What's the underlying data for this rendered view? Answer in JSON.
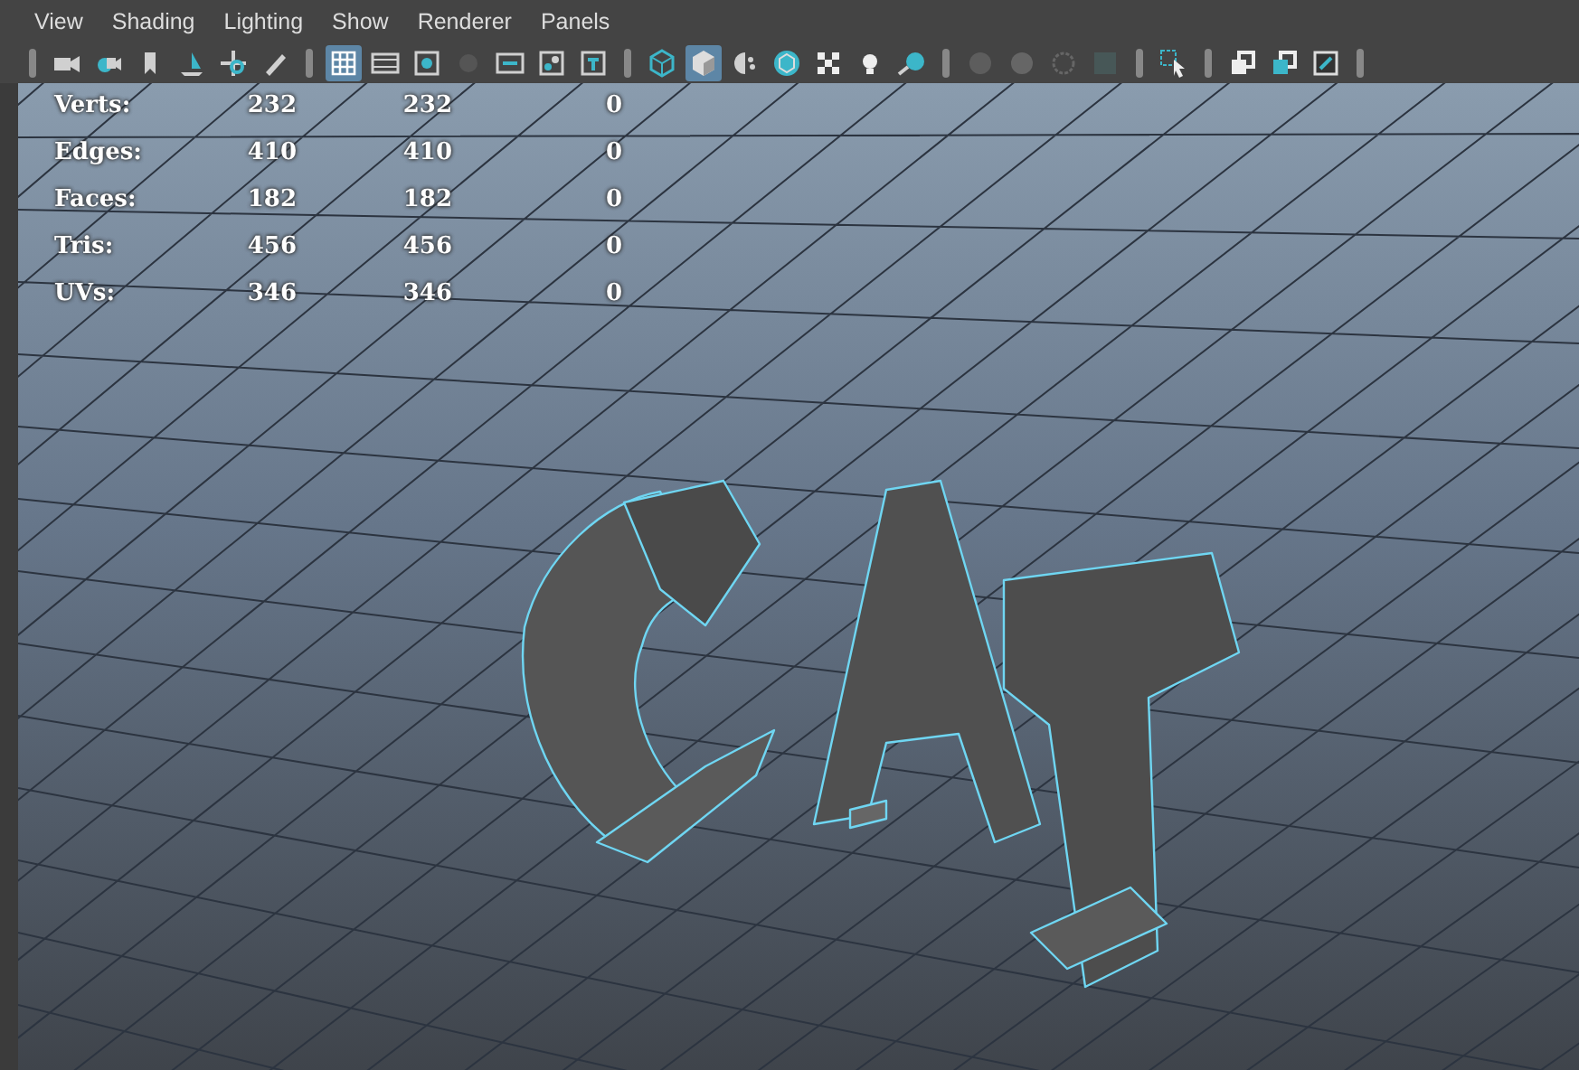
{
  "menu": [
    "View",
    "Shading",
    "Lighting",
    "Show",
    "Renderer",
    "Panels"
  ],
  "toolbar": [
    {
      "items": [
        {
          "selected": false,
          "disabled": false
        },
        {
          "selected": false,
          "disabled": false
        },
        {
          "selected": false,
          "disabled": false
        },
        {
          "selected": false,
          "disabled": false
        },
        {
          "selected": false,
          "disabled": false
        },
        {
          "selected": false,
          "disabled": false
        }
      ]
    },
    {
      "items": [
        {
          "selected": true,
          "disabled": false
        },
        {
          "selected": false,
          "disabled": false
        },
        {
          "selected": false,
          "disabled": false
        },
        {
          "selected": false,
          "disabled": true
        },
        {
          "selected": false,
          "disabled": false
        },
        {
          "selected": false,
          "disabled": false
        },
        {
          "selected": false,
          "disabled": false
        }
      ]
    },
    {
      "items": [
        {
          "selected": false,
          "disabled": false
        },
        {
          "selected": true,
          "disabled": false
        },
        {
          "selected": false,
          "disabled": false
        },
        {
          "selected": false,
          "disabled": false
        },
        {
          "selected": false,
          "disabled": false
        },
        {
          "selected": false,
          "disabled": false
        },
        {
          "selected": false,
          "disabled": false
        }
      ]
    },
    {
      "items": [
        {
          "selected": false,
          "disabled": true
        },
        {
          "selected": false,
          "disabled": true
        },
        {
          "selected": false,
          "disabled": true
        },
        {
          "selected": false,
          "disabled": true
        }
      ]
    },
    {
      "items": [
        {
          "selected": false,
          "disabled": false
        }
      ]
    },
    {
      "items": [
        {
          "selected": false,
          "disabled": false
        },
        {
          "selected": false,
          "disabled": false
        },
        {
          "selected": false,
          "disabled": false
        }
      ]
    }
  ],
  "stats": [
    {
      "label": "Verts:",
      "values": [
        "232",
        "232",
        "0"
      ]
    },
    {
      "label": "Edges:",
      "values": [
        "410",
        "410",
        "0"
      ]
    },
    {
      "label": "Faces:",
      "values": [
        "182",
        "182",
        "0"
      ]
    },
    {
      "label": "Tris:",
      "values": [
        "456",
        "456",
        "0"
      ]
    },
    {
      "label": "UVs:",
      "values": [
        "346",
        "346",
        "0"
      ]
    }
  ]
}
